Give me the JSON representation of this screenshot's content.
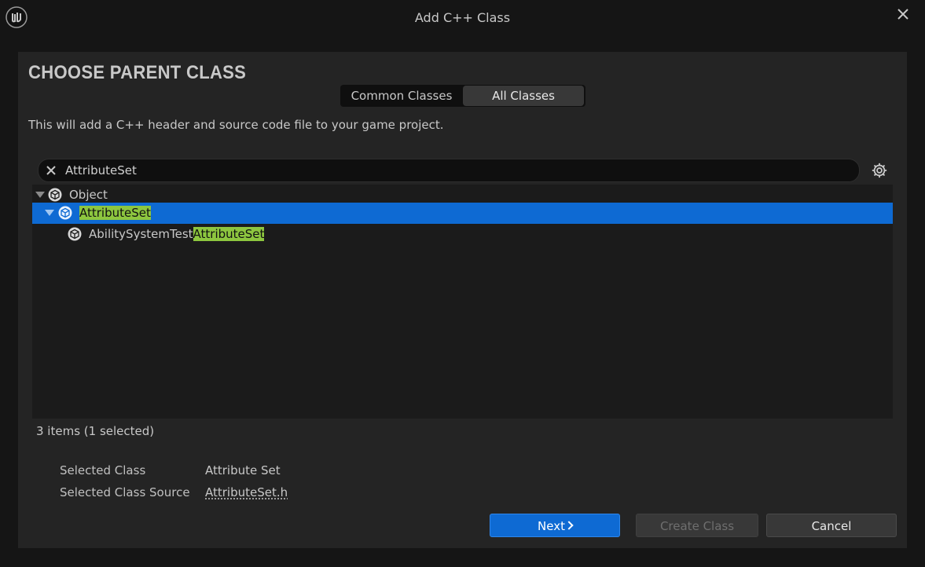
{
  "window": {
    "title": "Add C++ Class",
    "logo_icon": "unreal-engine-logo-icon",
    "close_icon": "close-icon"
  },
  "header": {
    "heading": "CHOOSE PARENT CLASS",
    "tabs": [
      {
        "label": "Common Classes",
        "selected": false
      },
      {
        "label": "All Classes",
        "selected": true
      }
    ],
    "description": "This will add a C++ header and source code file to your game project."
  },
  "search": {
    "value": "AttributeSet",
    "clear_icon": "clear-search-icon",
    "settings_icon": "gear-icon"
  },
  "tree": {
    "rows": [
      {
        "text": "Object",
        "highlight": "",
        "expanded": true,
        "selected": false
      },
      {
        "text": "",
        "highlight": "AttributeSet",
        "expanded": true,
        "selected": true
      },
      {
        "text": "AbilitySystemTest",
        "highlight": "AttributeSet",
        "expanded": false,
        "selected": false
      }
    ],
    "class_icon": "class-icon"
  },
  "status": {
    "count": "3 items (1 selected)"
  },
  "details": {
    "selected_class_label": "Selected Class",
    "selected_class_value": "Attribute Set",
    "selected_source_label": "Selected Class Source",
    "selected_source_value": "AttributeSet.h"
  },
  "buttons": {
    "next": "Next",
    "create": "Create Class",
    "cancel": "Cancel"
  },
  "colors": {
    "accent": "#0e6ad3",
    "highlight": "#8dc63f",
    "panel": "#242424",
    "background": "#151515"
  }
}
